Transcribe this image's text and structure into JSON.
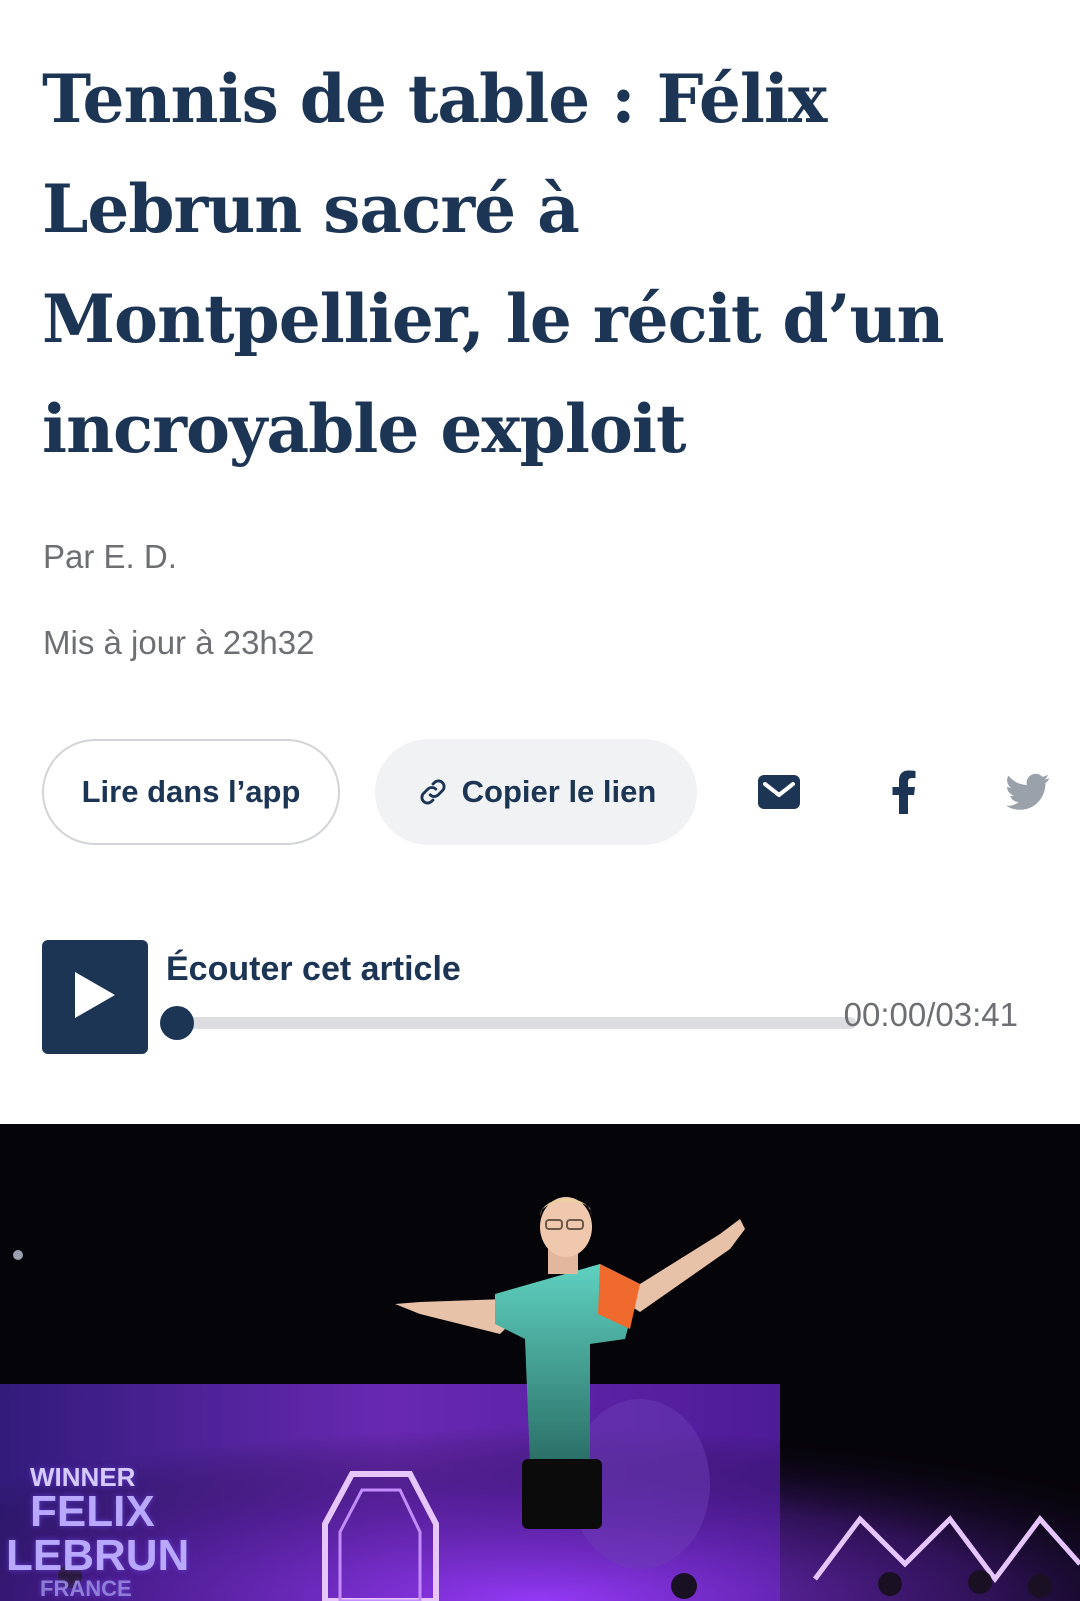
{
  "article": {
    "headline": "Tennis de table : Félix Lebrun sacré à Montpellier, le récit d’un incroyable exploit",
    "byline": "Par E. D.",
    "updated": "Mis à jour à 23h32"
  },
  "actions": {
    "read_in_app": "Lire dans l’app",
    "copy_link": "Copier le lien",
    "icons": [
      "link-icon",
      "mail-icon",
      "facebook-icon",
      "twitter-icon"
    ]
  },
  "audio": {
    "title": "Écouter cet article",
    "time": "00:00/03:41",
    "progress": 0
  },
  "hero": {
    "caption_winner": "WINNER",
    "caption_first": "FELIX",
    "caption_last": "LEBRUN",
    "caption_country": "FRANCE"
  },
  "colors": {
    "brand_navy": "#1c3554",
    "meta_gray": "#6d6f73",
    "twitter_gray": "#9aa1ab"
  }
}
